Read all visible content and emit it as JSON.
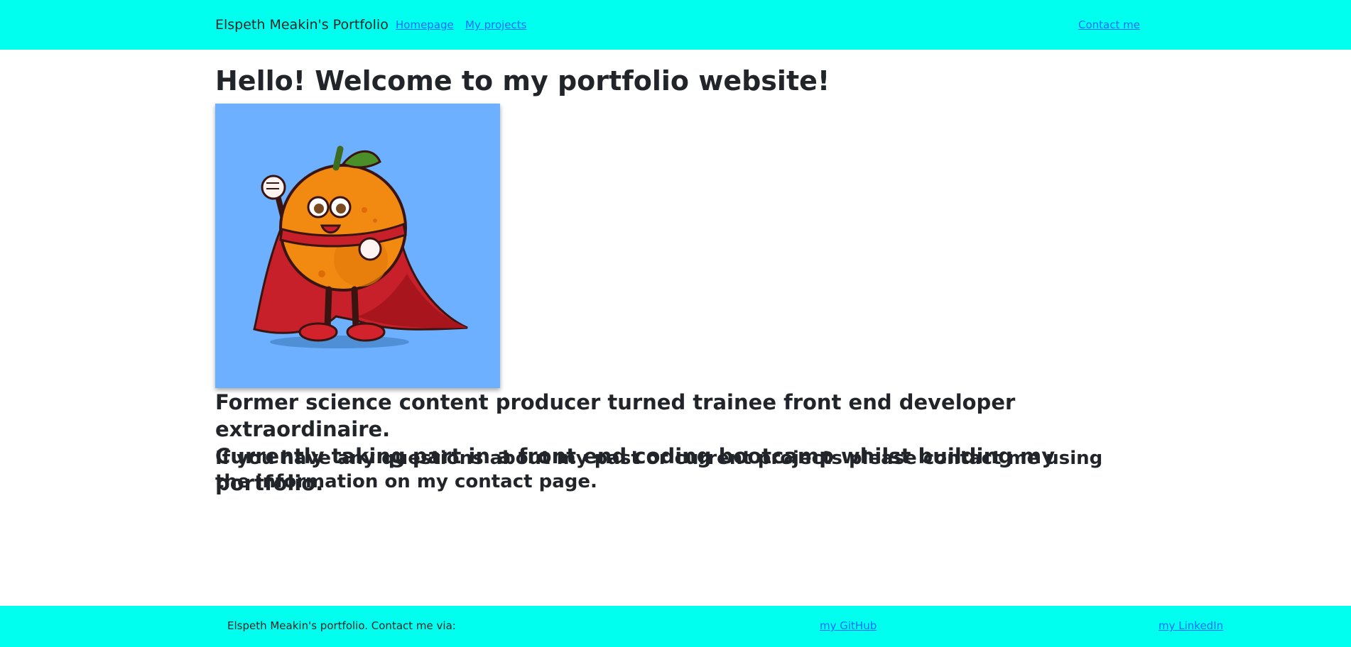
{
  "nav": {
    "brand": "Elspeth Meakin's Portfolio",
    "links": [
      {
        "label": "Homepage"
      },
      {
        "label": "My projects"
      }
    ],
    "contact": "Contact me"
  },
  "main": {
    "title": "Hello! Welcome to my portfolio website!",
    "image": {
      "subject": "orange-superhero-illustration",
      "background_color": "#6cb0ff"
    },
    "intro_line1": "Former science content producer turned trainee front end developer extraordinaire.",
    "intro_line2": "Currently taking part in a front end coding bootcamp whilst building my portfolio.",
    "contact_note": "If you have any questions about my past or current projects please contact me using the information on my contact page."
  },
  "footer": {
    "text": "Elspeth Meakin's portfolio. Contact me via:",
    "github": "my GitHub",
    "linkedin": "my LinkedIn"
  },
  "colors": {
    "nav_background": "#00ffee",
    "link": "#0d6efd",
    "text": "#212529"
  }
}
